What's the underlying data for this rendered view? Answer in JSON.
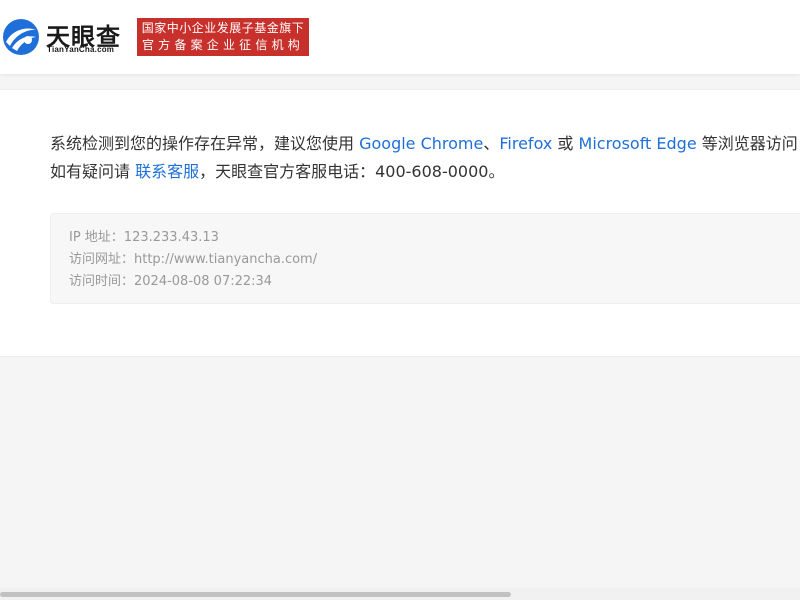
{
  "header": {
    "logo_name": "天眼查",
    "logo_domain": "TianYanCha.com",
    "badge_line1": "国家中小企业发展子基金旗下",
    "badge_line2": "官方备案企业征信机构"
  },
  "message": {
    "line1_prefix": "系统检测到您的操作存在异常，建议您使用 ",
    "browser1": "Google Chrome",
    "sep1": "、",
    "browser2": "Firefox",
    "sep2": " 或 ",
    "browser3": "Microsoft Edge",
    "line1_suffix": " 等浏览器访问",
    "line2_prefix": "如有疑问请 ",
    "contact_link": "联系客服",
    "line2_suffix": "，天眼查官方客服电话：400-608-0000。"
  },
  "info": {
    "ip": "IP 地址：123.233.43.13",
    "url": "访问网址：http://www.tianyancha.com/",
    "time": "访问时间：2024-08-08 07:22:34"
  },
  "colors": {
    "link": "#1e6fd9",
    "badge": "#c8302c",
    "logo_blue": "#1e6fd9"
  }
}
